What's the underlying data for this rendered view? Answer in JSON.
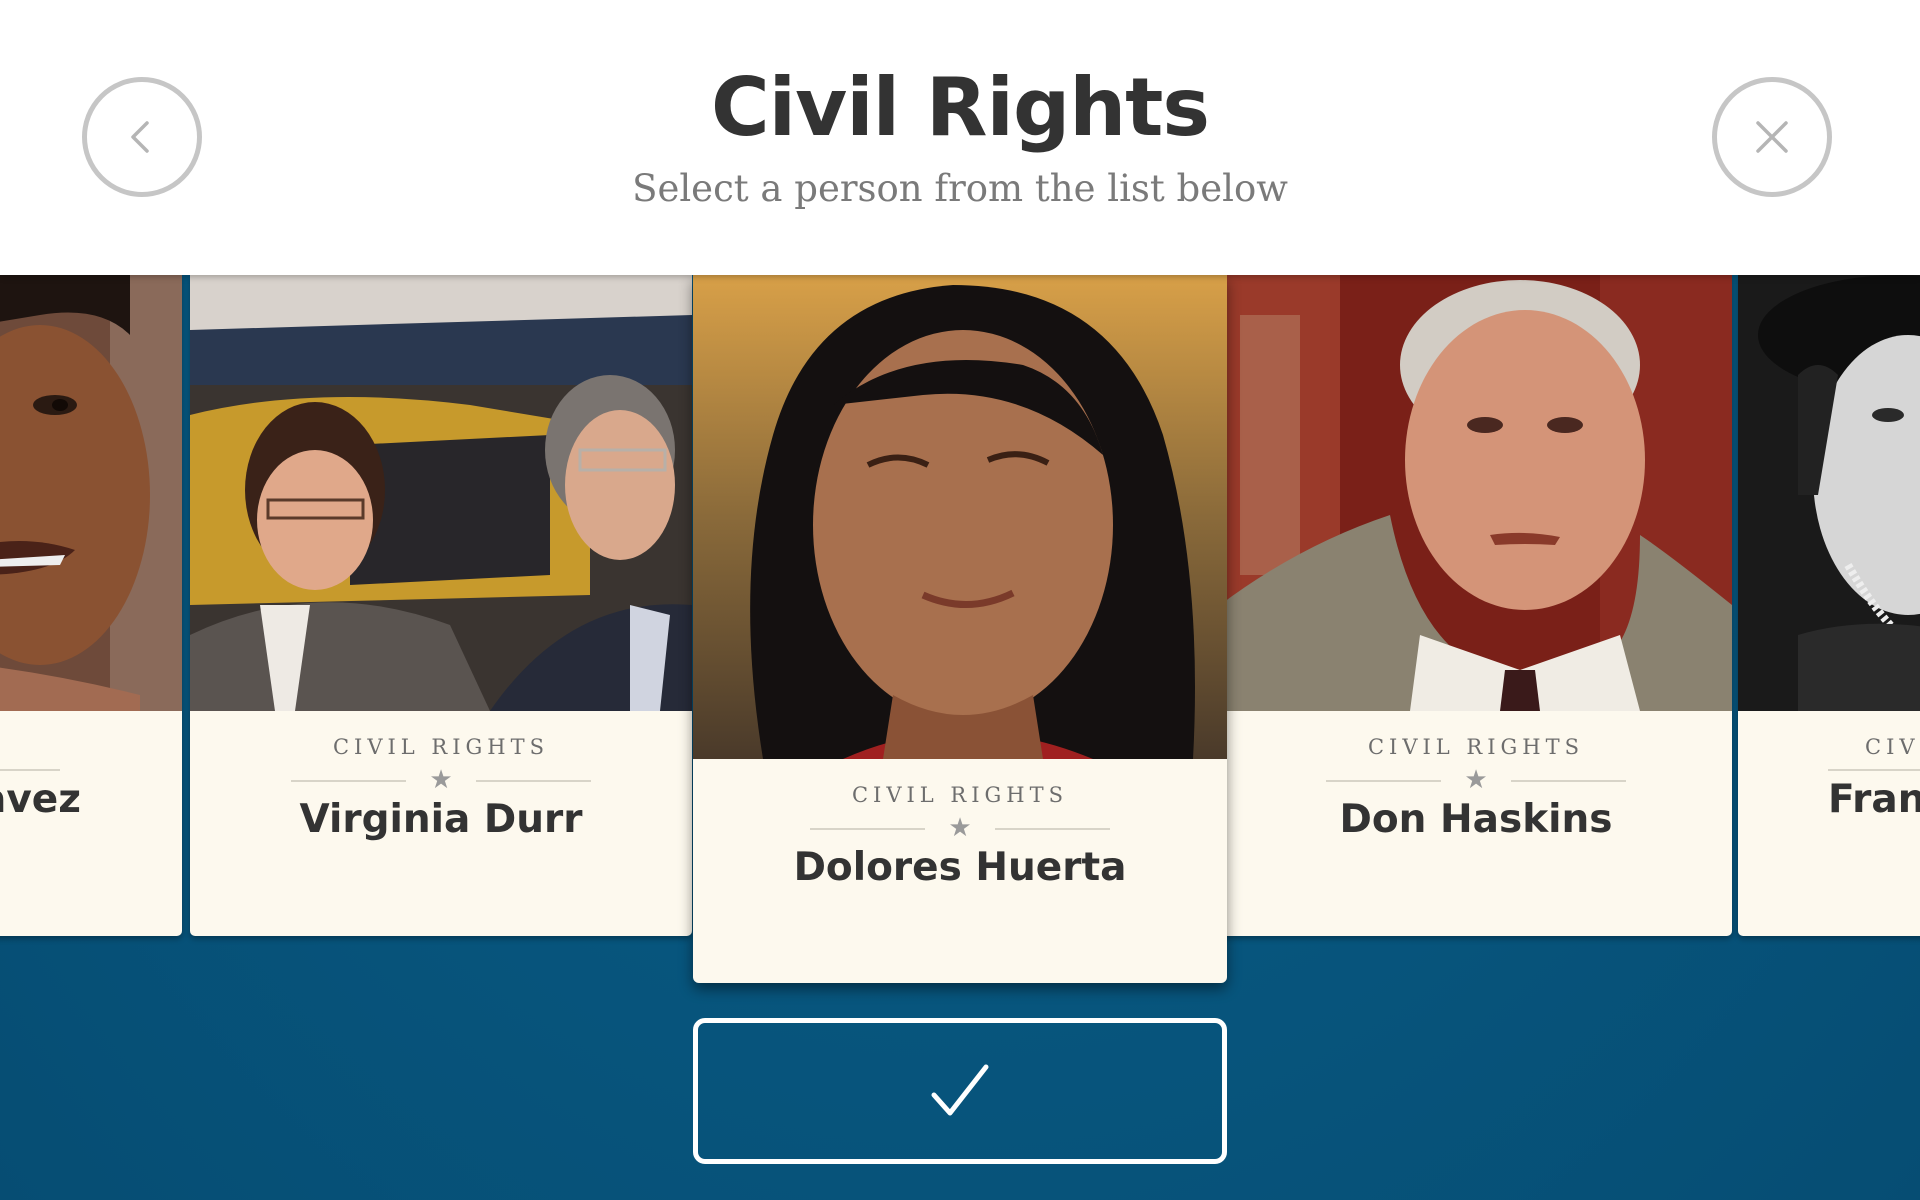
{
  "header": {
    "title": "Civil Rights",
    "subtitle": "Select a person from the list below"
  },
  "cards": [
    {
      "category": "CIVIL RIGHTS",
      "name": "Cesar Chavez",
      "visible_name": "avez",
      "visible_category": "S",
      "selected": false
    },
    {
      "category": "CIVIL RIGHTS",
      "name": "Virginia Durr",
      "selected": false
    },
    {
      "category": "CIVIL RIGHTS",
      "name": "Dolores Huerta",
      "selected": true
    },
    {
      "category": "CIVIL RIGHTS",
      "name": "Don Haskins",
      "selected": false
    },
    {
      "category": "CIVIL RIGHTS",
      "name": "Frances Perkins",
      "visible_name": "Franc",
      "visible_category": "CIV",
      "selected": false
    }
  ],
  "icons": {
    "back": "chevron-left-icon",
    "close": "close-icon",
    "confirm": "checkmark-icon",
    "divider": "star-icon"
  },
  "colors": {
    "background": "#085a83",
    "card": "#fdf9ee",
    "text_dark": "#333333",
    "text_muted": "#7a7a7a",
    "button_ring": "#c6c6c6"
  }
}
